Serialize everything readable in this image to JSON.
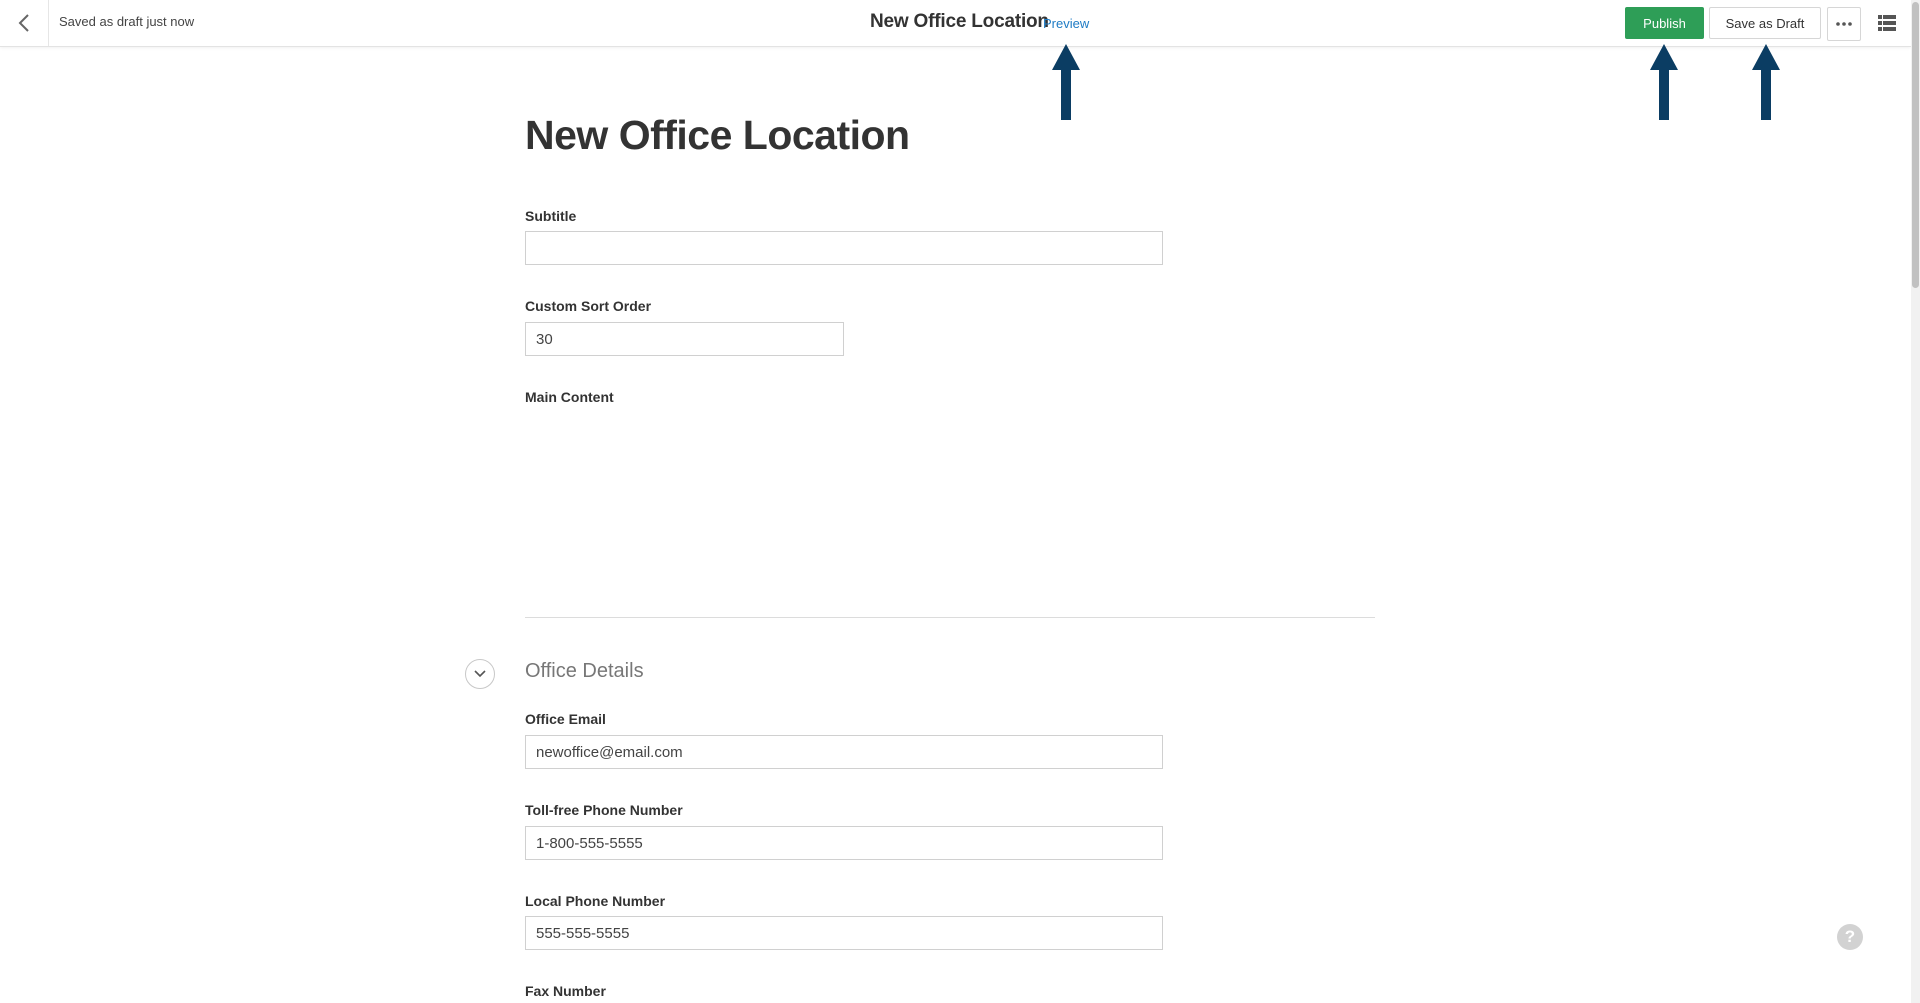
{
  "header": {
    "back_icon": "chevron-left-icon",
    "save_status": "Saved as draft just now",
    "title": "New Office Location",
    "preview_label": "Preview",
    "publish_label": "Publish",
    "save_draft_label": "Save as Draft",
    "more_icon": "ellipsis-icon",
    "list_icon": "list-view-icon"
  },
  "main": {
    "title": "New Office Location",
    "fields": {
      "subtitle": {
        "label": "Subtitle",
        "value": ""
      },
      "sort_order": {
        "label": "Custom Sort Order",
        "value": "30"
      },
      "main_content": {
        "label": "Main Content"
      }
    },
    "office_details": {
      "title": "Office Details",
      "email": {
        "label": "Office Email",
        "value": "newoffice@email.com"
      },
      "tollfree": {
        "label": "Toll-free Phone Number",
        "value": "1-800-555-5555"
      },
      "local": {
        "label": "Local Phone Number",
        "value": "555-555-5555"
      },
      "fax": {
        "label": "Fax Number"
      }
    }
  },
  "help_label": "?",
  "colors": {
    "publish": "#2e9e57",
    "link": "#1e7bc4",
    "arrow": "#0b3d63"
  }
}
